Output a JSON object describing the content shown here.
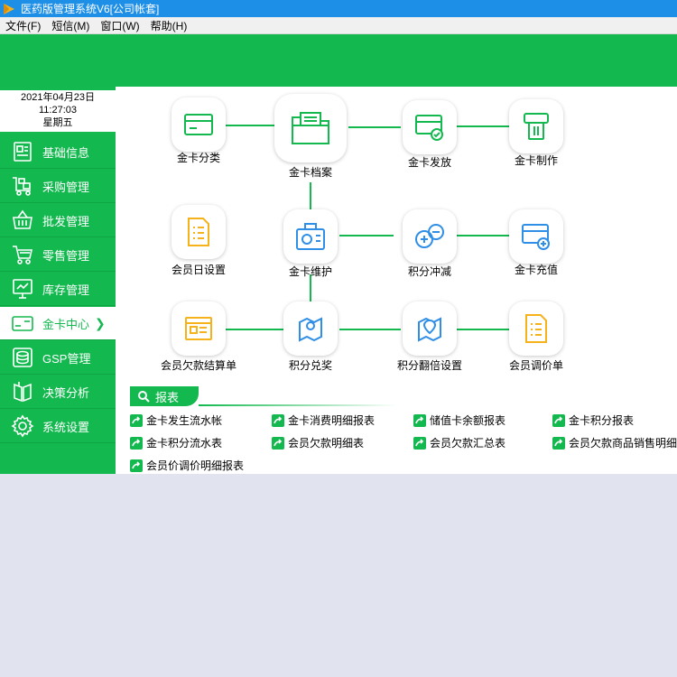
{
  "window": {
    "title": "医药版管理系统V6[公司帐套]"
  },
  "menubar": [
    "文件(F)",
    "短信(M)",
    "窗口(W)",
    "帮助(H)"
  ],
  "datetime": {
    "date": "2021年04月23日",
    "time": "11:27:03",
    "weekday": "星期五"
  },
  "sidebar": {
    "items": [
      {
        "label": "基础信息",
        "icon": "info-icon"
      },
      {
        "label": "采购管理",
        "icon": "truck-icon"
      },
      {
        "label": "批发管理",
        "icon": "basket-icon"
      },
      {
        "label": "零售管理",
        "icon": "cart-icon"
      },
      {
        "label": "库存管理",
        "icon": "board-icon"
      },
      {
        "label": "金卡中心",
        "icon": "card-icon",
        "active": true
      },
      {
        "label": "GSP管理",
        "icon": "coins-icon"
      },
      {
        "label": "决策分析",
        "icon": "book-icon"
      },
      {
        "label": "系统设置",
        "icon": "gear-icon"
      }
    ]
  },
  "tiles": [
    {
      "label": "金卡分类",
      "icon": "card-category-icon"
    },
    {
      "label": "金卡档案",
      "icon": "folder-icon"
    },
    {
      "label": "金卡发放",
      "icon": "card-issue-icon"
    },
    {
      "label": "金卡制作",
      "icon": "card-make-icon"
    },
    {
      "label": "会员日设置",
      "icon": "member-day-icon"
    },
    {
      "label": "金卡维护",
      "icon": "card-maintain-icon"
    },
    {
      "label": "积分冲减",
      "icon": "points-offset-icon"
    },
    {
      "label": "金卡充值",
      "icon": "card-recharge-icon"
    },
    {
      "label": "会员欠款结算单",
      "icon": "debt-settle-icon"
    },
    {
      "label": "积分兑奖",
      "icon": "map-pin-icon"
    },
    {
      "label": "积分翻倍设置",
      "icon": "map-pin-double-icon"
    },
    {
      "label": "会员调价单",
      "icon": "price-adjust-icon"
    }
  ],
  "reports": {
    "title": "报表",
    "links": [
      "金卡发生流水帐",
      "金卡消费明细报表",
      "储值卡余额报表",
      "金卡积分报表",
      "金卡积分流水表",
      "会员欠款明细表",
      "会员欠款汇总表",
      "会员欠款商品销售明细",
      "会员价调价明细报表"
    ]
  },
  "colors": {
    "brand_green": "#13b94f",
    "titlebar_blue": "#1e8fe6",
    "accent_blue": "#2f8ee6",
    "accent_yellow": "#f5b21b"
  }
}
